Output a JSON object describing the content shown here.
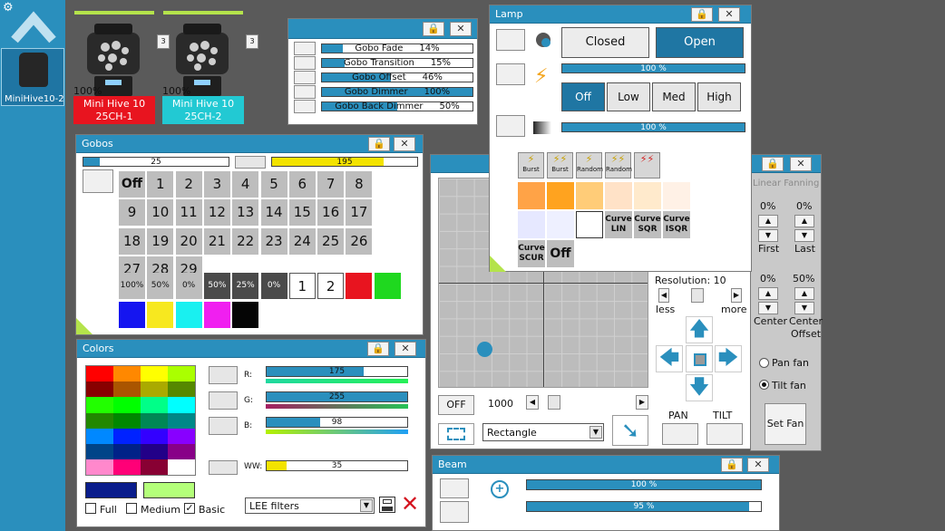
{
  "sidebar": {
    "fixture_label": "MiniHive10-2"
  },
  "fixtures": [
    {
      "percent": "100%",
      "name_line1": "Mini Hive 10",
      "name_line2": "25CH-1",
      "badge": "3",
      "label_bg": "#e8141f"
    },
    {
      "percent": "100%",
      "name_line1": "Mini Hive 10",
      "name_line2": "25CH-2",
      "badge": "3",
      "label_bg": "#22c9d3"
    }
  ],
  "gobo_sliders": {
    "items": [
      {
        "label": "Gobo Fade",
        "value": "14%",
        "level": 0.14
      },
      {
        "label": "Gobo Transition",
        "value": "15%",
        "level": 0.15
      },
      {
        "label": "Gobo Offset",
        "value": "46%",
        "level": 0.46
      },
      {
        "label": "Gobo Dimmer",
        "value": "100%",
        "level": 1.0
      },
      {
        "label": "Gobo Back Dimmer",
        "value": "50%",
        "level": 0.5
      }
    ]
  },
  "gobos": {
    "title": "Gobos",
    "bar1_value": "25",
    "bar2_value": "195",
    "off_label": "Off",
    "numbers": [
      "1",
      "2",
      "3",
      "4",
      "5",
      "6",
      "7",
      "8",
      "9",
      "10",
      "11",
      "12",
      "13",
      "14",
      "15",
      "16",
      "17",
      "18",
      "19",
      "20",
      "21",
      "22",
      "23",
      "24",
      "25",
      "26",
      "27",
      "28",
      "29"
    ],
    "fx_labels": [
      "100%",
      "50%",
      "0%",
      "50%",
      "25%",
      "0%"
    ],
    "wheel_labels": [
      "1",
      "2"
    ],
    "colors": [
      "#e8141f",
      "#1fd81f",
      "#1515f0",
      "#f7e81f",
      "#19f0f0",
      "#f01ff0",
      "#050505"
    ]
  },
  "colors_panel": {
    "title": "Colors",
    "r_label": "R:",
    "r_value": "175",
    "g_label": "G:",
    "g_value": "255",
    "b_label": "B:",
    "b_value": "98",
    "ww_label": "WW:",
    "ww_value": "35",
    "checks": [
      {
        "label": "Full",
        "checked": false
      },
      {
        "label": "Medium",
        "checked": false
      },
      {
        "label": "Basic",
        "checked": true
      }
    ],
    "filter_select": "LEE filters",
    "grid": [
      "#ff0000",
      "#ff8800",
      "#ffff00",
      "#aaff00",
      "#880000",
      "#aa5500",
      "#aaaa00",
      "#558800",
      "#22ff00",
      "#00ff00",
      "#00ff88",
      "#00ffff",
      "#228800",
      "#008800",
      "#008855",
      "#008888",
      "#0088ff",
      "#0022ff",
      "#3300ff",
      "#8800ff",
      "#004488",
      "#002288",
      "#220088",
      "#880088",
      "#ff88cc",
      "#ff0077",
      "#880033",
      "#ffffff"
    ],
    "current_color": "#0a1d8c",
    "prev_color": "#b4ff7a"
  },
  "lamp": {
    "title": "Lamp",
    "closed": "Closed",
    "open": "Open",
    "bar1": "100 %",
    "bar2": "100 %",
    "strobe": [
      "Off",
      "Low",
      "Med",
      "High"
    ],
    "effects": [
      "Burst",
      "Burst",
      "Random",
      "Random",
      ""
    ],
    "curves": [
      "Curve LIN",
      "Curve SQR",
      "Curve ISQR",
      "Curve SCUR"
    ],
    "off_label": "Off"
  },
  "position": {
    "resolution": "Resolution: 10",
    "less": "less",
    "more": "more",
    "off": "OFF",
    "speed": "1000",
    "shape": "Rectangle",
    "pan": "PAN",
    "tilt": "TILT"
  },
  "fanning": {
    "title": "Linear Fanning",
    "first_val": "0%",
    "last_val": "0%",
    "first": "First",
    "last": "Last",
    "center_val": "0%",
    "offset_val": "50%",
    "center": "Center",
    "center_offset_1": "Center",
    "center_offset_2": "Offset",
    "pan_fan": "Pan fan",
    "tilt_fan": "Tilt fan",
    "set_fan": "Set Fan"
  },
  "beam": {
    "title": "Beam",
    "bar1": "100 %",
    "bar2": "95 %",
    "bar2_level": 0.95
  }
}
